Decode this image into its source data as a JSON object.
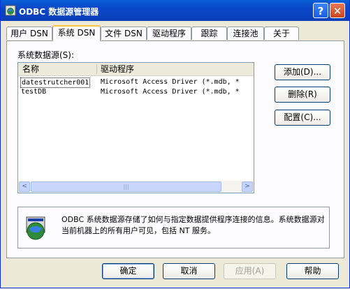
{
  "window": {
    "title": "ODBC 数据源管理器",
    "help_label": "?",
    "close_label": "✕"
  },
  "tabs": [
    {
      "label": "用户 DSN"
    },
    {
      "label": "系统 DSN"
    },
    {
      "label": "文件 DSN"
    },
    {
      "label": "驱动程序"
    },
    {
      "label": "跟踪"
    },
    {
      "label": "连接池"
    },
    {
      "label": "关于"
    }
  ],
  "active_tab": "系统 DSN",
  "main": {
    "group_label": "系统数据源(S):",
    "columns": {
      "name": "名称",
      "driver": "驱动程序"
    },
    "rows": [
      {
        "name": "datestrutcher001",
        "driver": "Microsoft Access Driver (*.mdb, *"
      },
      {
        "name": "testDB",
        "driver": "Microsoft Access Driver (*.mdb, *"
      }
    ],
    "scroll_left": "<",
    "scroll_right": ">",
    "scroll_grip": "|||"
  },
  "side_buttons": {
    "add": "添加(D)...",
    "remove": "删除(R)",
    "configure": "配置(C)..."
  },
  "info": {
    "text": "ODBC 系统数据源存储了如何与指定数据提供程序连接的信息。系统数据源对当前机器上的所有用户可见，包括 NT 服务。"
  },
  "footer": {
    "ok": "确定",
    "cancel": "取消",
    "apply": "应用(A)",
    "help": "帮助"
  },
  "colors": {
    "title_bar": "#0a4fd0",
    "active_tab_accent": "#ffc83c",
    "face": "#ece9d8"
  }
}
